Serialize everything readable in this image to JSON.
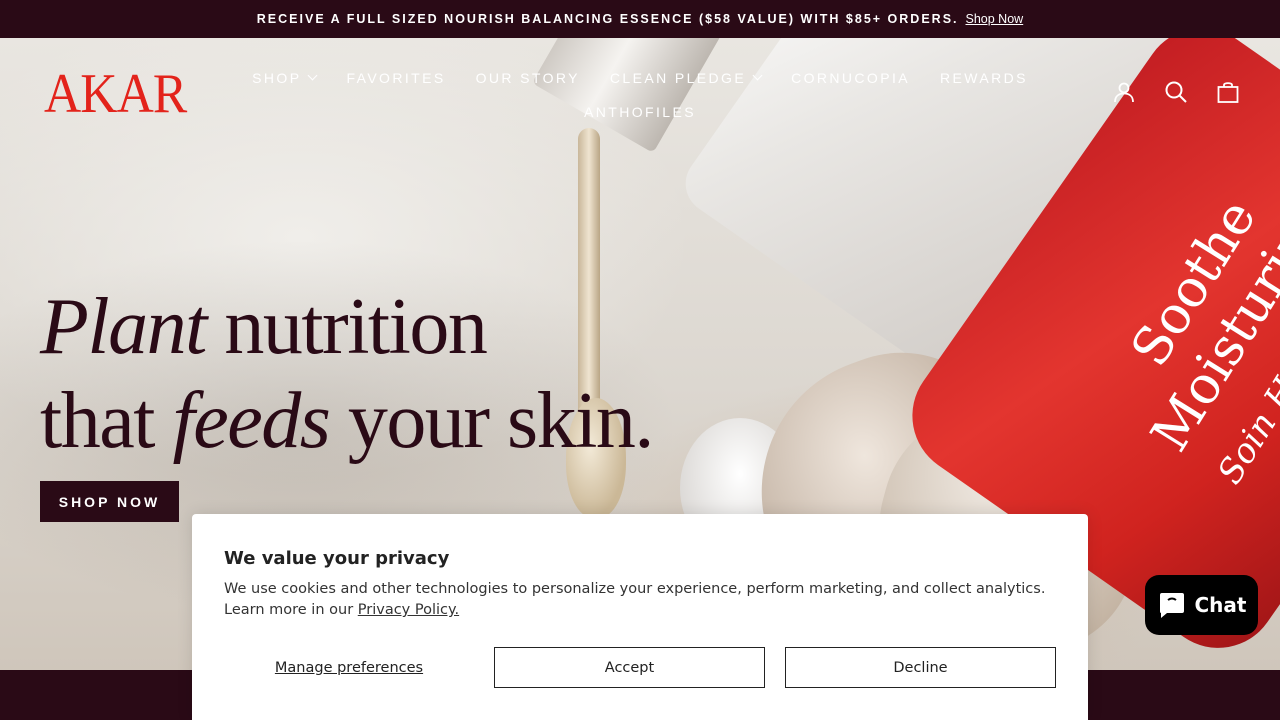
{
  "announcement": {
    "text": "RECEIVE A FULL SIZED NOURISH BALANCING ESSENCE ($58 VALUE) WITH $85+ ORDERS.",
    "link": "Shop Now"
  },
  "header": {
    "logo": "AKAR",
    "nav": [
      {
        "label": "SHOP",
        "dropdown": true
      },
      {
        "label": "FAVORITES",
        "dropdown": false
      },
      {
        "label": "OUR STORY",
        "dropdown": false
      },
      {
        "label": "CLEAN PLEDGE",
        "dropdown": true
      },
      {
        "label": "CORNUCOPIA",
        "dropdown": false
      },
      {
        "label": "REWARDS",
        "dropdown": false
      },
      {
        "label": "ANTHOFILES",
        "dropdown": false
      }
    ],
    "icons": [
      "account-icon",
      "search-icon",
      "cart-icon"
    ]
  },
  "hero": {
    "line1_italic": "Plant",
    "line1_rest": " nutrition",
    "line2_start": "that ",
    "line2_italic": "feeds",
    "line2_end": " your skin.",
    "cta": "SHOP NOW",
    "product_text": [
      "Soothe",
      "Moisturiz",
      "Soin He"
    ]
  },
  "privacy": {
    "title": "We value your privacy",
    "body": "We use cookies and other technologies to personalize your experience, perform marketing, and collect analytics. Learn more in our ",
    "policy_link": "Privacy Policy.",
    "manage": "Manage preferences",
    "accept": "Accept",
    "decline": "Decline"
  },
  "chat": {
    "label": "Chat"
  },
  "colors": {
    "brand_dark": "#2a0a16",
    "logo_red": "#e3231b"
  }
}
